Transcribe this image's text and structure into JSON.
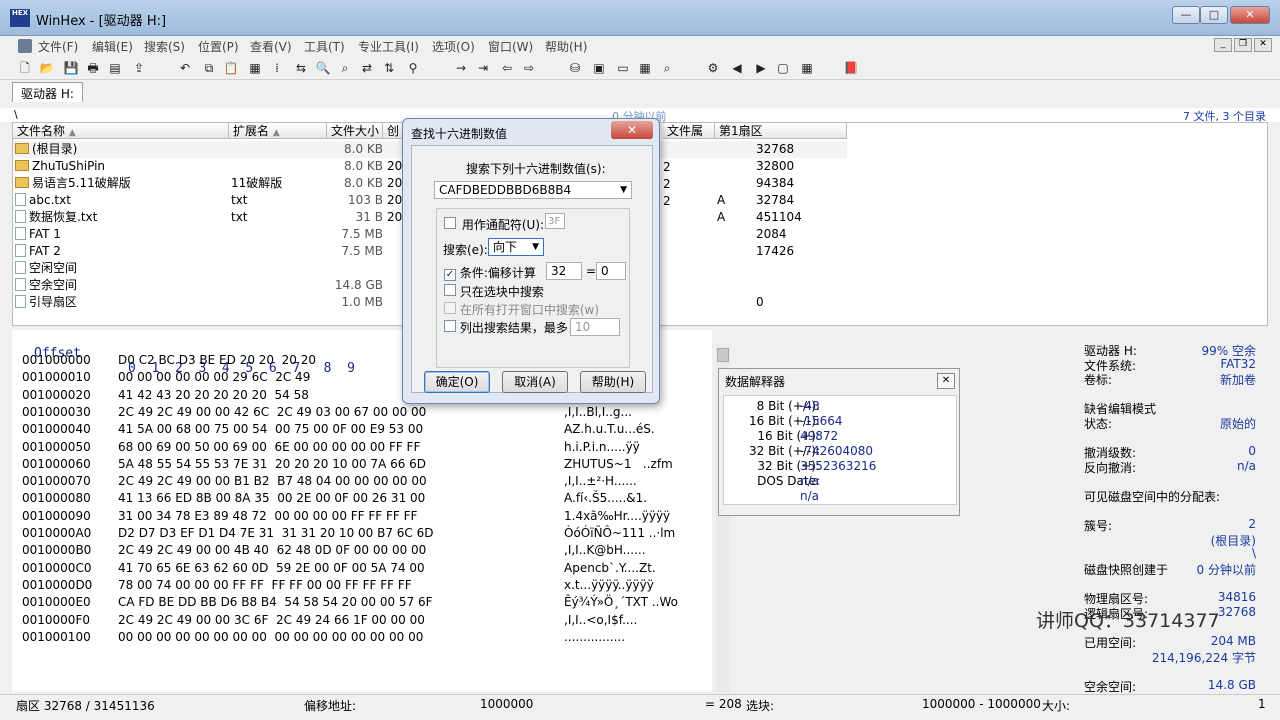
{
  "window": {
    "app_title": "WinHex - [驱动器 H:]",
    "icon_text": "HEX",
    "min": "—",
    "max": "□",
    "close": "✕"
  },
  "menu": [
    "文件(F)",
    "编辑(E)",
    "搜索(S)",
    "位置(P)",
    "查看(V)",
    "工具(T)",
    "专业工具(I)",
    "选项(O)",
    "窗口(W)",
    "帮助(H)"
  ],
  "tab": {
    "label": "驱动器 H:"
  },
  "pathbar": {
    "path": "\\",
    "center": "0 分钟以前",
    "right": "7 文件, 3 个目录"
  },
  "dir": {
    "headers": {
      "name": "文件名称",
      "ext": "扩展名",
      "size": "文件大小",
      "created": "创",
      "attr": "文件属",
      "first_sector": "第1扇区"
    },
    "rows": [
      {
        "name": "(根目录)",
        "ext": "",
        "size": "8.0 KB",
        "created": "",
        "attr": "",
        "first_sector": "32768",
        "kind": "folder"
      },
      {
        "name": "ZhuTuShiPin",
        "ext": "",
        "size": "8.0 KB",
        "created": "20",
        "attr": "",
        "first_sector": "32800",
        "kind": "folder"
      },
      {
        "name": "易语言5.11破解版",
        "ext": "11破解版",
        "size": "8.0 KB",
        "created": "20",
        "attr": "",
        "first_sector": "94384",
        "kind": "folder"
      },
      {
        "name": "abc.txt",
        "ext": "txt",
        "size": "103 B",
        "created": "20",
        "attr": "A",
        "first_sector": "32784",
        "kind": "file"
      },
      {
        "name": "数据恢复.txt",
        "ext": "txt",
        "size": "31 B",
        "created": "20",
        "attr": "A",
        "first_sector": "451104",
        "kind": "file"
      },
      {
        "name": "FAT 1",
        "ext": "",
        "size": "7.5 MB",
        "created": "",
        "attr": "",
        "first_sector": "2084",
        "kind": "file"
      },
      {
        "name": "FAT 2",
        "ext": "",
        "size": "7.5 MB",
        "created": "",
        "attr": "",
        "first_sector": "17426",
        "kind": "file"
      },
      {
        "name": "空闲空间",
        "ext": "",
        "size": "",
        "created": "",
        "attr": "",
        "first_sector": "",
        "kind": "file"
      },
      {
        "name": "空余空间",
        "ext": "",
        "size": "14.8 GB",
        "created": "",
        "attr": "",
        "first_sector": "",
        "kind": "file"
      },
      {
        "name": "引导扇区",
        "ext": "",
        "size": "1.0 MB",
        "created": "",
        "attr": "",
        "first_sector": "0",
        "kind": "file"
      }
    ],
    "right_col": [
      "2",
      "2",
      "2"
    ]
  },
  "hex": {
    "header_offset": "Offset",
    "header_cols": "0  1  2  3  4  5  6  7   8  9",
    "rows": [
      {
        "off": "001000000",
        "bytes": "D0 C2 BC D3 BE ED 20 20  20 20",
        "ascii": "....."
      },
      {
        "off": "001000010",
        "bytes": "00 00 00 00 00 00 29 6C  2C 49",
        "ascii": "......"
      },
      {
        "off": "001000020",
        "bytes": "41 42 43 20 20 20 20 20  54 58",
        "ascii": "     ^B1"
      },
      {
        "off": "001000030",
        "bytes": "2C 49 2C 49 00 00 42 6C  2C 49 03 00 67 00 00 00",
        "ascii": ",I,I..Bl,I..g..."
      },
      {
        "off": "001000040",
        "bytes": "41 5A 00 68 00 75 00 54  00 75 00 0F 00 E9 53 00",
        "ascii": "AZ.h.u.T.u...éS."
      },
      {
        "off": "001000050",
        "bytes": "68 00 69 00 50 00 69 00  6E 00 00 00 00 00 FF FF",
        "ascii": "h.i.P.i.n.....ÿÿ"
      },
      {
        "off": "001000060",
        "bytes": "5A 48 55 54 55 53 7E 31  20 20 20 10 00 7A 66 6D",
        "ascii": "ZHUTUS~1   ..zfm"
      },
      {
        "off": "001000070",
        "bytes": "2C 49 2C 49 00 00 B1 B2  B7 48 04 00 00 00 00 00",
        "ascii": ",I,I..±²·H......"
      },
      {
        "off": "001000080",
        "bytes": "41 13 66 ED 8B 00 8A 35  00 2E 00 0F 00 26 31 00",
        "ascii": "A.fí‹.Š5.....&1."
      },
      {
        "off": "001000090",
        "bytes": "31 00 34 78 E3 89 48 72  00 00 00 00 FF FF FF FF",
        "ascii": "1.4xã‰Hr....ÿÿÿÿ"
      },
      {
        "off": "0010000A0",
        "bytes": "D2 D7 D3 EF D1 D4 7E 31  31 31 20 10 00 B7 6C 6D",
        "ascii": "ÒóÓïÑÔ~111 ..·lm"
      },
      {
        "off": "0010000B0",
        "bytes": "2C 49 2C 49 00 00 4B 40  62 48 0D 0F 00 00 00 00",
        "ascii": ",I,I..K@bH......"
      },
      {
        "off": "0010000C0",
        "bytes": "41 70 65 6E 63 62 60 0D  59 2E 00 0F 00 5A 74 00",
        "ascii": "Apencb`.Y....Zt."
      },
      {
        "off": "0010000D0",
        "bytes": "78 00 74 00 00 00 FF FF  FF FF 00 00 FF FF FF FF",
        "ascii": "x.t...ÿÿÿÿ..ÿÿÿÿ"
      },
      {
        "off": "0010000E0",
        "bytes": "CA FD BE DD BB D6 B8 B4  54 58 54 20 00 00 57 6F",
        "ascii": "Êý¾Ý»Ö¸´TXT ..Wo"
      },
      {
        "off": "0010000F0",
        "bytes": "2C 49 2C 49 00 00 3C 6F  2C 49 24 66 1F 00 00 00",
        "ascii": ",I,I..<o,I$f...."
      },
      {
        "off": "001000100",
        "bytes": "00 00 00 00 00 00 00 00  00 00 00 00 00 00 00 00",
        "ascii": "................"
      }
    ]
  },
  "info": [
    {
      "k": "驱动器 H:",
      "v": "99% 空余"
    },
    {
      "k": "文件系统:",
      "v": "FAT32"
    },
    {
      "k": "卷标:",
      "v": "新加卷"
    },
    {
      "k": "",
      "v": ""
    },
    {
      "k": "缺省编辑模式",
      "v": ""
    },
    {
      "k": "状态:",
      "v": "原始的"
    },
    {
      "k": "",
      "v": ""
    },
    {
      "k": "撤消级数:",
      "v": "0"
    },
    {
      "k": "反向撤消:",
      "v": "n/a"
    },
    {
      "k": "",
      "v": ""
    },
    {
      "k": "可见磁盘空间中的分配表:",
      "v": ""
    },
    {
      "k": "",
      "v": ""
    },
    {
      "k": "簇号:",
      "v": "2"
    },
    {
      "k": "",
      "v": "(根目录)"
    },
    {
      "k": "",
      "v": "\\"
    },
    {
      "k": "磁盘快照创建于",
      "v": "0 分钟以前"
    },
    {
      "k": "",
      "v": ""
    },
    {
      "k": "物理扇区号:",
      "v": "34816"
    },
    {
      "k": "逻辑扇区号:",
      "v": "32768"
    },
    {
      "k": "",
      "v": ""
    },
    {
      "k": "已用空间:",
      "v": "204 MB"
    },
    {
      "k": "",
      "v": "214,196,224 字节"
    },
    {
      "k": "",
      "v": ""
    },
    {
      "k": "空余空间:",
      "v": "14.8 GB"
    }
  ],
  "status": {
    "sector": "扇区 32768 / 31451136",
    "offset_label": "偏移地址:",
    "offset_value": "1000000",
    "eq": "= 208",
    "sel_label": "选块:",
    "sel_value": "1000000 - 1000000",
    "size_label": "大小:",
    "size_value": "1"
  },
  "dialog": {
    "title": "查找十六进制数值",
    "close": "✕",
    "search_label": "搜索下列十六进制数值(s):",
    "search_value": "CAFDBEDDBBD6B8B4",
    "wildcard_label": "用作通配符(U):",
    "wildcard_value": "3F",
    "direction_label": "搜索(e):",
    "direction_value": "向下",
    "cond_label": "条件:偏移计算",
    "cond_mod": "32",
    "cond_eq": "=",
    "cond_val": "0",
    "block_label": "只在选块中搜索",
    "allwin_label": "在所有打开窗口中搜索(w)",
    "list_label": "列出搜索结果，最多",
    "list_value": "10",
    "ok": "确定(O)",
    "cancel": "取消(A)",
    "help": "帮助(H)"
  },
  "interpreter": {
    "title": "数据解释器",
    "close": "✕",
    "rows": [
      {
        "k": "8 Bit (+/-):",
        "v": "-48"
      },
      {
        "k": "16 Bit (+/-):",
        "v": "-15664"
      },
      {
        "k": "16 Bit (+):",
        "v": "49872"
      },
      {
        "k": "32 Bit (+/-):",
        "v": "-742604080"
      },
      {
        "k": "32 Bit (+):",
        "v": "3552363216"
      },
      {
        "k": "DOS Date:",
        "v": "n/a"
      },
      {
        "k": "",
        "v": "n/a"
      }
    ]
  },
  "watermark": "讲师QQ：33714377"
}
